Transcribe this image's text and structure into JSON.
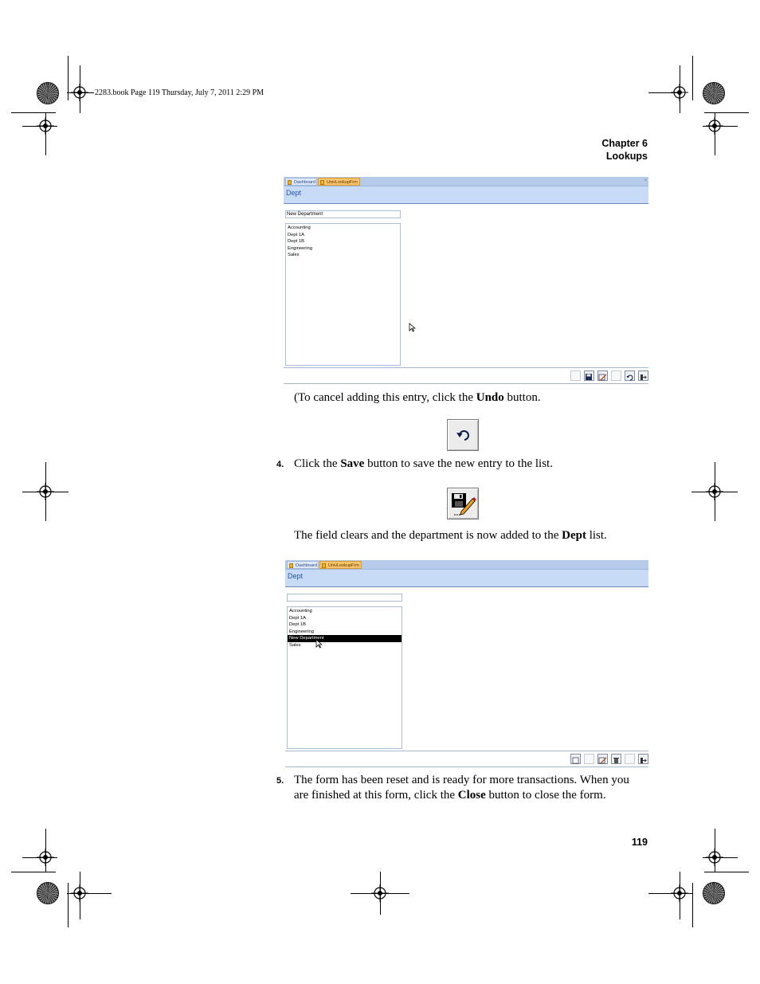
{
  "slug": "2283.book  Page 119  Thursday, July 7, 2011  2:29 PM",
  "running_head": {
    "chapter": "Chapter 6",
    "title": "Lookups"
  },
  "screenshot1": {
    "tabs": [
      "Dashboard",
      "UnivLookupFrm"
    ],
    "close": "×",
    "header": "Dept",
    "field_value": "New Department",
    "list": [
      "Accounting",
      "Dept 1A",
      "Dept 1B",
      "Engineering",
      "Sales"
    ]
  },
  "para1": {
    "pre": "(To cancel adding this entry, click the ",
    "bold": "Undo",
    "post": " button."
  },
  "step4": {
    "num": "4.",
    "pre": "Click the ",
    "bold": "Save",
    "post": " button to save the new entry to the list."
  },
  "para2": {
    "pre": "The field clears and the department is now added to the ",
    "bold": "Dept",
    "post": " list."
  },
  "screenshot2": {
    "tabs": [
      "Dashboard",
      "UnivLookupFrm"
    ],
    "header": "Dept",
    "field_value": "",
    "list": [
      "Accounting",
      "Dept 1A",
      "Dept 1B",
      "Engineering",
      "New Department",
      "Sales"
    ],
    "selected": "New Department"
  },
  "step5": {
    "num": "5.",
    "line1": "The form has been reset and is ready for more transactions. When you",
    "line2_pre": "are finished at this form, click the ",
    "bold": "Close",
    "line2_post": " button to close the form."
  },
  "page_number": "119",
  "icons": {
    "undo": "undo-icon",
    "save": "save-icon"
  }
}
